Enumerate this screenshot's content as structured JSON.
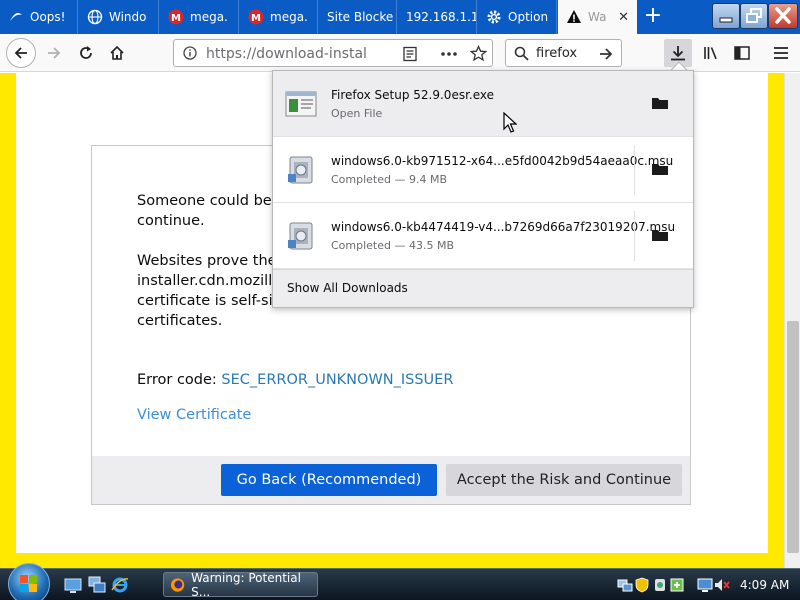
{
  "tabs": [
    {
      "title": "Oops!",
      "icon": "oops-icon"
    },
    {
      "title": "Windo",
      "icon": "globe-icon"
    },
    {
      "title": "mega.",
      "icon": "mega-icon"
    },
    {
      "title": "mega.",
      "icon": "mega-icon"
    },
    {
      "title": "Site Blocke",
      "icon": "none"
    },
    {
      "title": "192.168.1.1",
      "icon": "none"
    },
    {
      "title": "Option",
      "icon": "gear-icon"
    },
    {
      "title": "Wa",
      "icon": "warning-icon"
    }
  ],
  "navbar": {
    "url": "https://download-installer.cdn.mozilla.net",
    "search_query": "firefox"
  },
  "downloads": {
    "items": [
      {
        "name": "Firefox Setup 52.9.0esr.exe",
        "status": "Open File"
      },
      {
        "name": "windows6.0-kb971512-x64...e5fd0042b9d54aeaa0c.msu",
        "status": "Completed — 9.4 MB"
      },
      {
        "name": "windows6.0-kb4474419-v4...b7269d66a7f23019207.msu",
        "status": "Completed — 43.5 MB"
      }
    ],
    "show_all_label": "Show All Downloads"
  },
  "error_page": {
    "para1_line1": "Someone could be t",
    "para1_line2": "continue.",
    "para2_line1": "Websites prove their",
    "para2_line2": "installer.cdn.mozilla.",
    "para2_line3": "certificate is self-sign",
    "para2_line4": "certificates.",
    "error_code_label": "Error code: ",
    "error_code": "SEC_ERROR_UNKNOWN_ISSUER",
    "view_certificate": "View Certificate",
    "go_back": "Go Back (Recommended)",
    "accept": "Accept the Risk and Continue"
  },
  "taskbar": {
    "task_title": "Warning: Potential S...",
    "clock": "4:09 AM"
  },
  "colors": {
    "tabstrip": "#0a5cc4",
    "warning_border": "#ffe900",
    "primary_button": "#0a61d8",
    "link": "#3d8fd3"
  }
}
